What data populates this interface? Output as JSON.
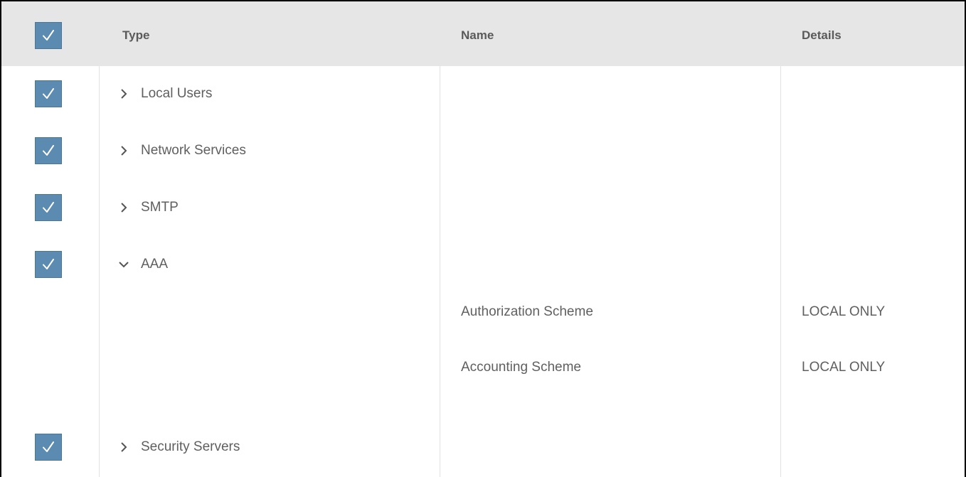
{
  "header": {
    "type_label": "Type",
    "name_label": "Name",
    "details_label": "Details",
    "select_all_checked": true
  },
  "rows": [
    {
      "type": "Local Users",
      "expanded": false,
      "checked": true
    },
    {
      "type": "Network Services",
      "expanded": false,
      "checked": true
    },
    {
      "type": "SMTP",
      "expanded": false,
      "checked": true
    },
    {
      "type": "AAA",
      "expanded": true,
      "checked": true,
      "children": [
        {
          "name": "Authorization Scheme",
          "details": "LOCAL ONLY"
        },
        {
          "name": "Accounting Scheme",
          "details": "LOCAL ONLY"
        }
      ]
    },
    {
      "type": "Security Servers",
      "expanded": false,
      "checked": true
    }
  ],
  "colors": {
    "header_bg": "#e6e6e6",
    "checkbox_bg": "#5b8bb1",
    "text": "#5f5f5f"
  },
  "icons": {
    "collapsed": "chevron-right-icon",
    "expanded": "chevron-down-icon",
    "check": "checkmark-icon"
  }
}
